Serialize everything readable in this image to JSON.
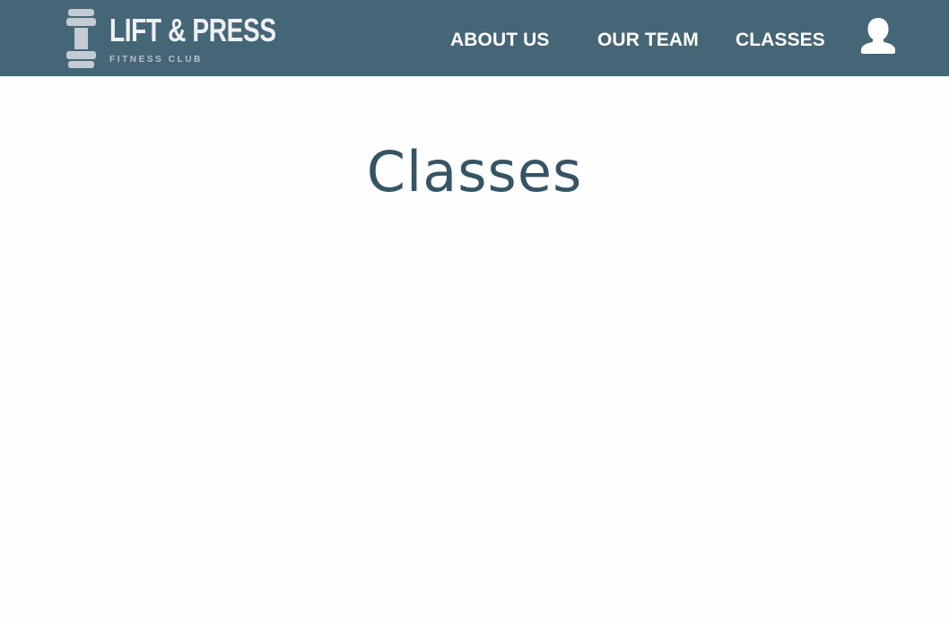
{
  "brand": {
    "name": "LIFT & PRESS",
    "tagline": "FITNESS CLUB",
    "logo_icon": "dumbbell-icon"
  },
  "nav": {
    "items": [
      {
        "label": "ABOUT US"
      },
      {
        "label": "OUR TEAM"
      },
      {
        "label": "CLASSES"
      }
    ],
    "account_icon": "user-avatar-icon"
  },
  "main": {
    "title": "Classes"
  },
  "colors": {
    "header_bg": "#446677",
    "title_text": "#355566",
    "logo_mark": "#c4cbd3",
    "nav_text": "#ffffff",
    "page_bg": "#fefefe"
  }
}
